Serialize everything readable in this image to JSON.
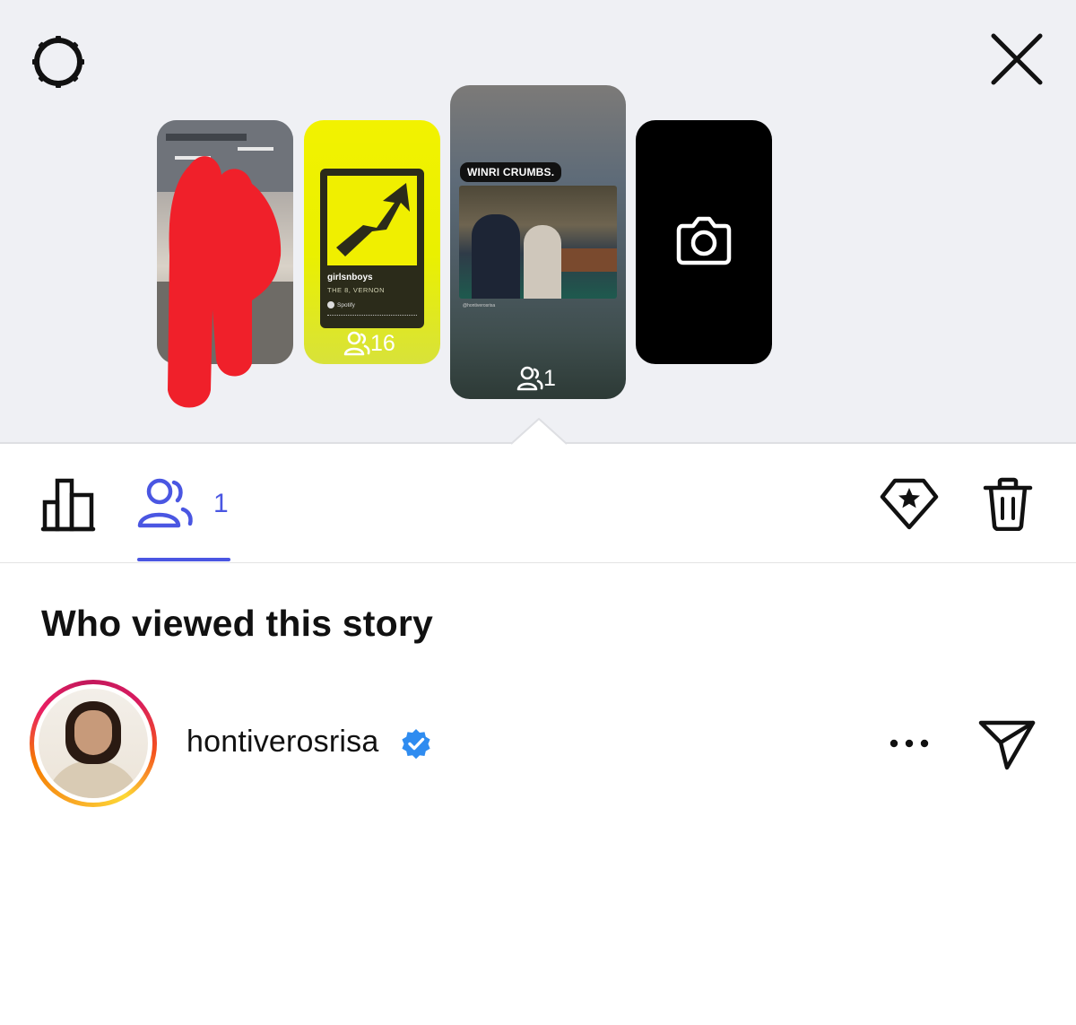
{
  "header": {
    "settings_icon": "gear-icon",
    "close_icon": "close-icon"
  },
  "stories": [
    {
      "kind": "photo",
      "redacted": true
    },
    {
      "kind": "spotify",
      "song_title": "girlsnboys",
      "artist": "THE 8, VERNON",
      "service_label": "Spotify",
      "viewers": "16"
    },
    {
      "kind": "news",
      "selected": true,
      "headline": "WINRI CRUMBS.",
      "credit": "@hontiverosrisa",
      "viewers": "1"
    },
    {
      "kind": "add",
      "icon": "camera-icon"
    }
  ],
  "tabs": {
    "insights_icon": "bar-chart-icon",
    "viewers_icon": "viewers-icon",
    "viewers_count": "1",
    "active": "viewers",
    "highlight_icon": "highlight-icon",
    "delete_icon": "trash-icon"
  },
  "section_title": "Who viewed this story",
  "viewers": [
    {
      "username": "hontiverosrisa",
      "verified": true,
      "more_icon": "more-icon",
      "send_icon": "send-icon"
    }
  ],
  "colors": {
    "accent": "#4a56e2",
    "top_background": "#eff0f4",
    "verified": "#2f8cf0",
    "story_ring_start": "#f9a825",
    "story_ring_end": "#d81b60"
  }
}
